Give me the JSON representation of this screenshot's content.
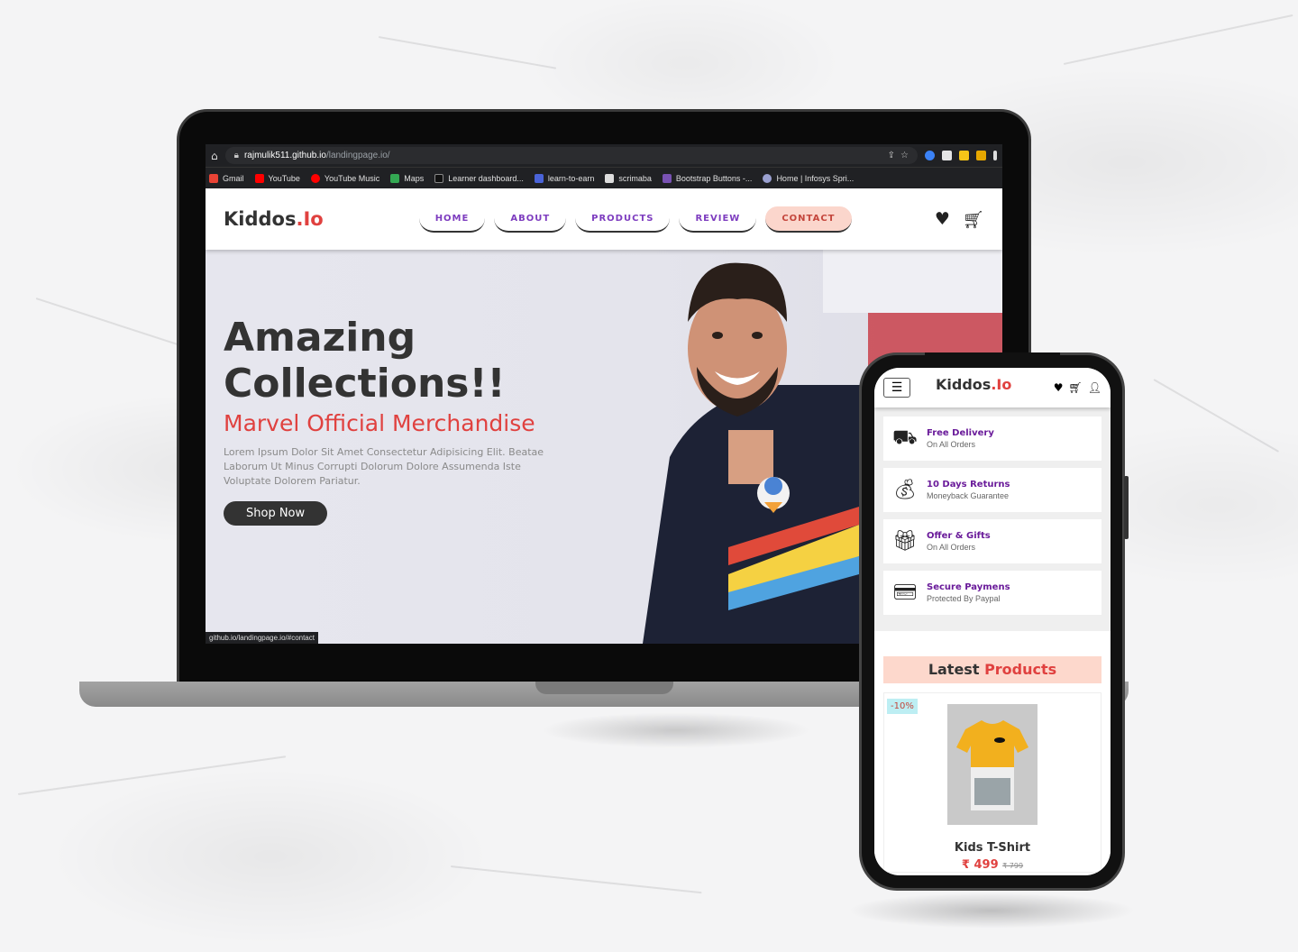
{
  "browser": {
    "url_domain": "rajmulik511.github.io",
    "url_path": "/landingpage.io/",
    "status_url": "github.io/landingpage.io/#contact"
  },
  "bookmarks": [
    {
      "label": "Gmail",
      "color": "#ea4335"
    },
    {
      "label": "YouTube",
      "color": "#ff0000"
    },
    {
      "label": "YouTube Music",
      "color": "#ff0000"
    },
    {
      "label": "Maps",
      "color": "#34a853"
    },
    {
      "label": "Learner dashboard...",
      "color": "#111111"
    },
    {
      "label": "learn-to-earn",
      "color": "#4a63d8"
    },
    {
      "label": "scrimaba",
      "color": "#dddddd"
    },
    {
      "label": "Bootstrap Buttons -...",
      "color": "#7952b3"
    },
    {
      "label": "Home | Infosys Spri...",
      "color": "#9aa0d0"
    }
  ],
  "site": {
    "logo_main": "Kiddos",
    "logo_accent": ".Io",
    "menu": [
      "HOME",
      "ABOUT",
      "PRODUCTS",
      "REVIEW",
      "CONTACT"
    ],
    "hero": {
      "title_line1": "Amazing",
      "title_line2": "Collections!!",
      "subtitle": "Marvel Official Merchandise",
      "lead": "Lorem Ipsum Dolor Sit Amet Consectetur Adipisicing Elit. Beatae Laborum Ut Minus Corrupti Dolorum Dolore Assumenda Iste Voluptate Dolorem Pariatur.",
      "button": "Shop Now"
    }
  },
  "mobile": {
    "logo_main": "Kiddos",
    "logo_accent": ".Io",
    "features": [
      {
        "title": "Free Delivery",
        "sub": "On All Orders",
        "icon": "delivery-icon"
      },
      {
        "title": "10 Days Returns",
        "sub": "Moneyback Guarantee",
        "icon": "money-bag-icon"
      },
      {
        "title": "Offer & Gifts",
        "sub": "On All Orders",
        "icon": "gift-icon"
      },
      {
        "title": "Secure Paymens",
        "sub": "Protected By Paypal",
        "icon": "credit-card-icon"
      }
    ],
    "latest_main": "Latest",
    "latest_accent": "Products",
    "product": {
      "discount": "-10%",
      "name": "Kids T-Shirt",
      "price": "₹ 499",
      "old_price": "₹ 799"
    }
  },
  "colors": {
    "accent_red": "#e0413f",
    "menu_purple": "#7d3cbf",
    "feature_purple": "#6a1b9a",
    "peach": "#fbd6cc"
  }
}
